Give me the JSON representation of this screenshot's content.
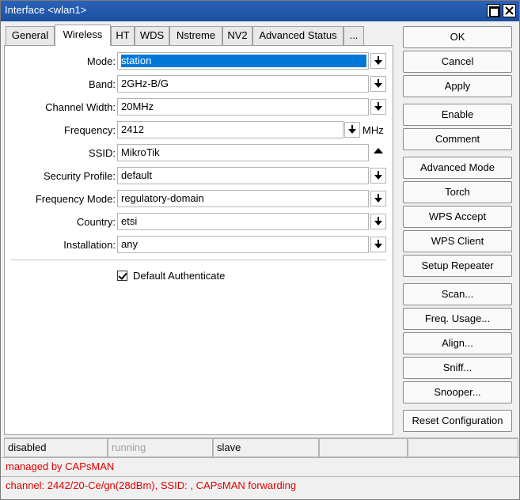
{
  "window": {
    "title": "Interface <wlan1>"
  },
  "tabs": [
    "General",
    "Wireless",
    "HT",
    "WDS",
    "Nstreme",
    "NV2",
    "Advanced Status",
    "..."
  ],
  "form": {
    "mode": {
      "label": "Mode:",
      "value": "station"
    },
    "band": {
      "label": "Band:",
      "value": "2GHz-B/G"
    },
    "channel_width": {
      "label": "Channel Width:",
      "value": "20MHz"
    },
    "frequency": {
      "label": "Frequency:",
      "value": "2412",
      "unit": "MHz"
    },
    "ssid": {
      "label": "SSID:",
      "value": "MikroTik"
    },
    "security_profile": {
      "label": "Security Profile:",
      "value": "default"
    },
    "frequency_mode": {
      "label": "Frequency Mode:",
      "value": "regulatory-domain"
    },
    "country": {
      "label": "Country:",
      "value": "etsi"
    },
    "installation": {
      "label": "Installation:",
      "value": "any"
    },
    "default_authenticate": {
      "label": "Default Authenticate",
      "checked": true
    }
  },
  "buttons": {
    "ok": "OK",
    "cancel": "Cancel",
    "apply": "Apply",
    "enable": "Enable",
    "comment": "Comment",
    "advanced_mode": "Advanced Mode",
    "torch": "Torch",
    "wps_accept": "WPS Accept",
    "wps_client": "WPS Client",
    "setup_repeater": "Setup Repeater",
    "scan": "Scan...",
    "freq_usage": "Freq. Usage...",
    "align": "Align...",
    "sniff": "Sniff...",
    "snooper": "Snooper...",
    "reset_configuration": "Reset Configuration"
  },
  "status": {
    "state": "disabled",
    "running": "running",
    "role": "slave",
    "managed": "managed by CAPsMAN",
    "channel": "channel: 2442/20-Ce/gn(28dBm), SSID: , CAPsMAN forwarding"
  },
  "colors": {
    "titlebar": "#1b4f9f",
    "selection": "#0078d7",
    "alert": "#e00000"
  }
}
